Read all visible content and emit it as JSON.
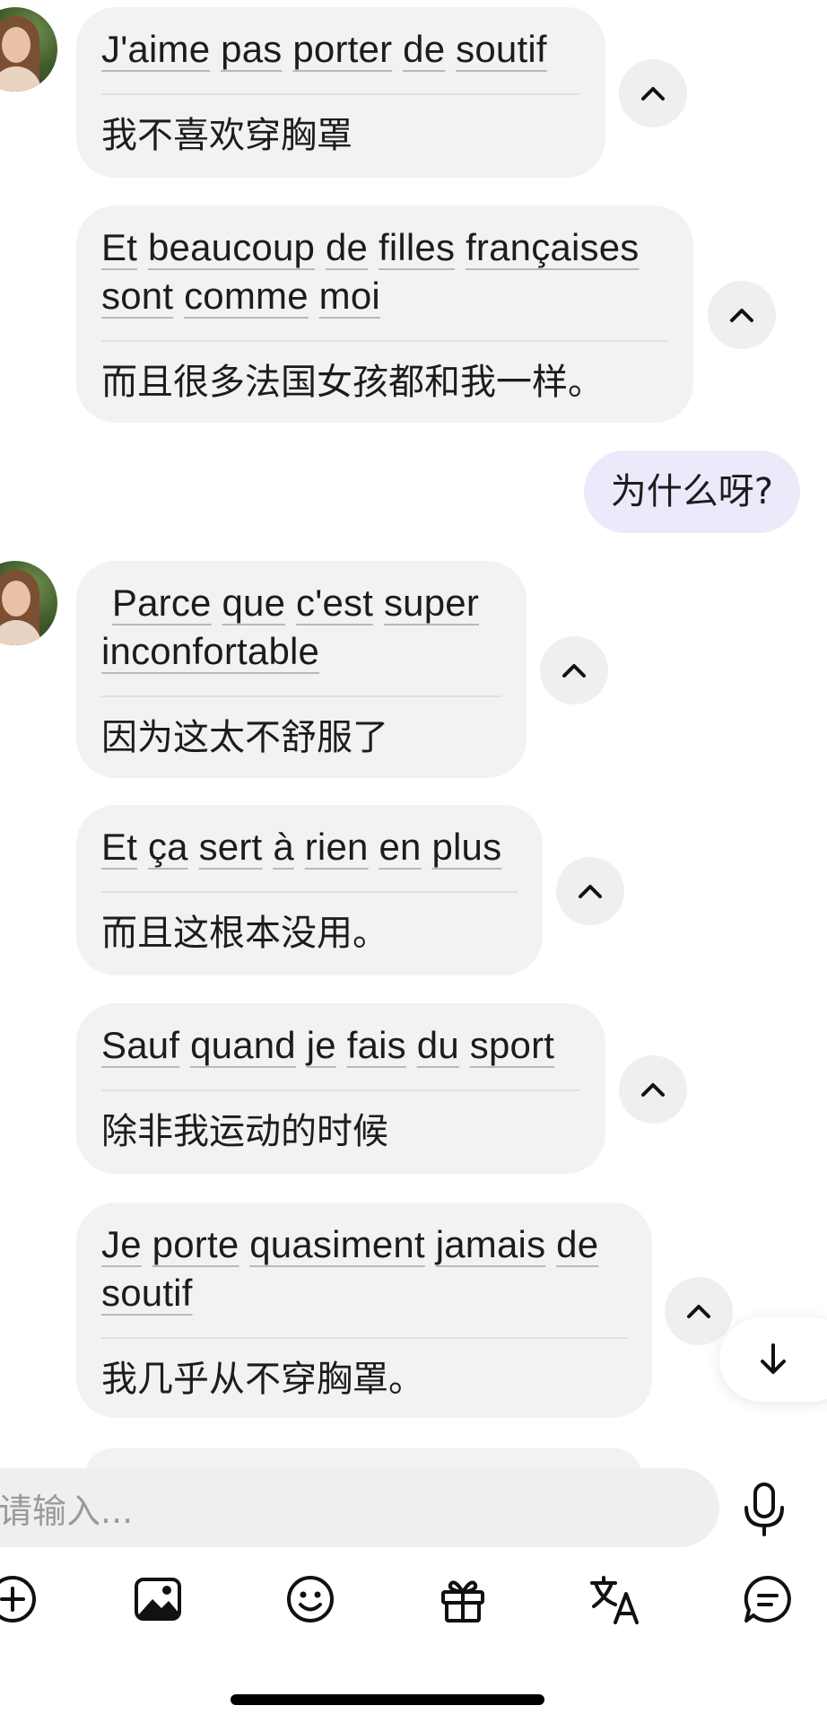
{
  "messages": [
    {
      "fr_words": [
        "J'aime",
        "pas",
        "porter",
        "de",
        "soutif"
      ],
      "zh": "我不喜欢穿胸罩"
    },
    {
      "fr_words": [
        "Et",
        "beaucoup",
        "de",
        "filles",
        "françaises",
        "sont",
        "comme",
        "moi"
      ],
      "zh": "而且很多法国女孩都和我一样。"
    },
    {
      "fr_words": [
        "Parce",
        "que",
        "c'est",
        "super",
        "inconfortable"
      ],
      "zh": "因为这太不舒服了"
    },
    {
      "fr_words": [
        "Et",
        "ça",
        "sert",
        "à",
        "rien",
        "en",
        "plus"
      ],
      "zh": "而且这根本没用。"
    },
    {
      "fr_words": [
        "Sauf",
        "quand",
        "je",
        "fais",
        "du",
        "sport"
      ],
      "zh": "除非我运动的时候"
    },
    {
      "fr_words": [
        "Je",
        "porte",
        "quasiment",
        "jamais",
        "de",
        "soutif"
      ],
      "zh": "我几乎从不穿胸罩。"
    }
  ],
  "my_message": "为什么呀?",
  "input": {
    "placeholder": "请输入..."
  },
  "icons": {
    "collapse": "chevron-up-icon",
    "scroll_down": "arrow-down-icon",
    "mic": "microphone-icon",
    "toolbar": [
      "plus-circle-icon",
      "image-icon",
      "emoji-icon",
      "gift-icon",
      "translate-icon",
      "chat-bubble-icon"
    ]
  },
  "colors": {
    "incoming_bubble": "#f2f2f2",
    "outgoing_bubble": "#ece9fb",
    "text": "#1c1c1e",
    "placeholder": "#9a9a9a"
  }
}
